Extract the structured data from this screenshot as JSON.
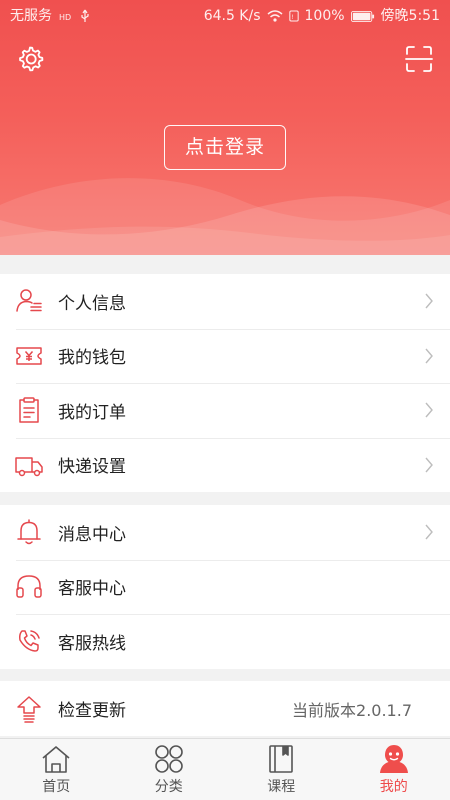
{
  "status_bar": {
    "carrier": "无服务",
    "network_speed": "64.5 K/s",
    "battery": "100%",
    "time": "傍晚5:51"
  },
  "header": {
    "login_label": "点击登录",
    "accent_color": "#f0504f"
  },
  "menu_groups": [
    {
      "items": [
        {
          "label": "个人信息",
          "icon": "user-info-icon"
        },
        {
          "label": "我的钱包",
          "icon": "wallet-icon"
        },
        {
          "label": "我的订单",
          "icon": "order-icon"
        },
        {
          "label": "快递设置",
          "icon": "delivery-truck-icon"
        }
      ]
    },
    {
      "items": [
        {
          "label": "消息中心",
          "icon": "bell-icon"
        },
        {
          "label": "客服中心",
          "icon": "headset-icon"
        },
        {
          "label": "客服热线",
          "icon": "phone-icon"
        }
      ]
    },
    {
      "items": [
        {
          "label": "检查更新",
          "icon": "upload-icon",
          "right_text": "当前版本2.0.1.7"
        }
      ]
    }
  ],
  "tabs": [
    {
      "label": "首页",
      "icon": "home-icon"
    },
    {
      "label": "分类",
      "icon": "category-icon"
    },
    {
      "label": "课程",
      "icon": "book-icon"
    },
    {
      "label": "我的",
      "icon": "profile-icon",
      "active": true
    }
  ]
}
